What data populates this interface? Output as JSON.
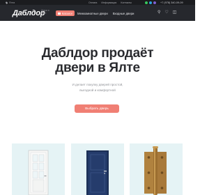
{
  "topbar": {
    "city": "Ялта",
    "links": [
      "Оплата",
      "Информация",
      "Контакты"
    ],
    "phone": "+7 (978) 340-09-09",
    "messengers": [
      {
        "icon": "whatsapp-icon",
        "color": "#37c75d"
      },
      {
        "icon": "telegram-icon",
        "color": "#2aa3dc"
      },
      {
        "icon": "viber-icon",
        "color": "#7e5fd1"
      }
    ]
  },
  "header": {
    "logo": "Даблдор",
    "tagline": "Двери в Ялте",
    "catalog": "Каталог",
    "nav": [
      "Межкомнатные двери",
      "Входные двери"
    ],
    "icons": [
      "search-icon",
      "favorites-icon",
      "cart-icon"
    ]
  },
  "hero": {
    "title_line1": "Даблдор продаёт",
    "title_line2": "двери в Ялте",
    "text_line1": "И делает покупку дверей простой,",
    "text_line2": "выгодной и комфортной",
    "cta": "Выбрать дверь"
  },
  "products": [
    {
      "name": "white-interior-door"
    },
    {
      "name": "blue-entrance-door"
    },
    {
      "name": "brass-door-hinge"
    }
  ],
  "colors": {
    "accent": "#f07f74",
    "header_bg": "#26282d",
    "topbar_bg": "#1b1c1f",
    "card_bg": "#e5f3f5",
    "door_blue": "#253c6c",
    "brass": "#b0823f"
  }
}
